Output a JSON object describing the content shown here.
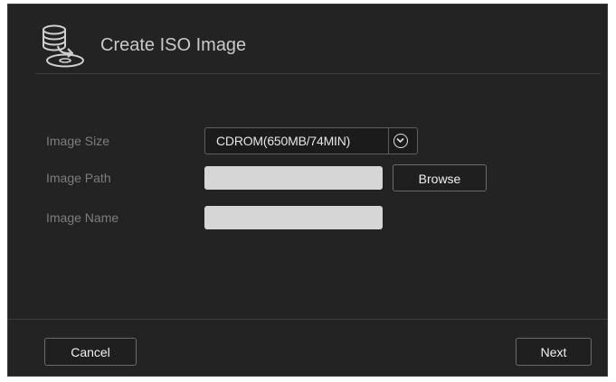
{
  "dialog": {
    "title": "Create ISO Image",
    "icon": "disc-image-create-icon"
  },
  "form": {
    "image_size": {
      "label": "Image Size",
      "selected": "CDROM(650MB/74MIN)",
      "dropdown_icon": "chevron-down-circle-icon"
    },
    "image_path": {
      "label": "Image Path",
      "value": "",
      "browse_label": "Browse"
    },
    "image_name": {
      "label": "Image Name",
      "value": ""
    }
  },
  "footer": {
    "cancel_label": "Cancel",
    "next_label": "Next"
  },
  "colors": {
    "background": "#232323",
    "input_fill": "#d6d6d6",
    "label_text": "#7d7d7d",
    "title_text": "#c9c9c9"
  }
}
